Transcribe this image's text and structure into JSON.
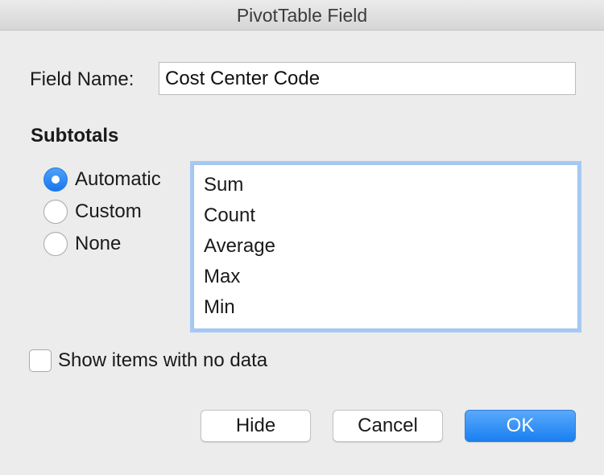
{
  "window": {
    "title": "PivotTable Field"
  },
  "field": {
    "label": "Field Name:",
    "value": "Cost Center Code"
  },
  "subtotals": {
    "title": "Subtotals",
    "options": [
      {
        "label": "Automatic",
        "selected": true
      },
      {
        "label": "Custom",
        "selected": false
      },
      {
        "label": "None",
        "selected": false
      }
    ],
    "functions": [
      "Sum",
      "Count",
      "Average",
      "Max",
      "Min"
    ]
  },
  "show_items": {
    "label": "Show items with no data",
    "checked": false
  },
  "buttons": {
    "hide": "Hide",
    "cancel": "Cancel",
    "ok": "OK"
  },
  "colors": {
    "accent": "#1a7ff1",
    "focus_ring": "#a6c9f3",
    "background": "#ececec"
  }
}
